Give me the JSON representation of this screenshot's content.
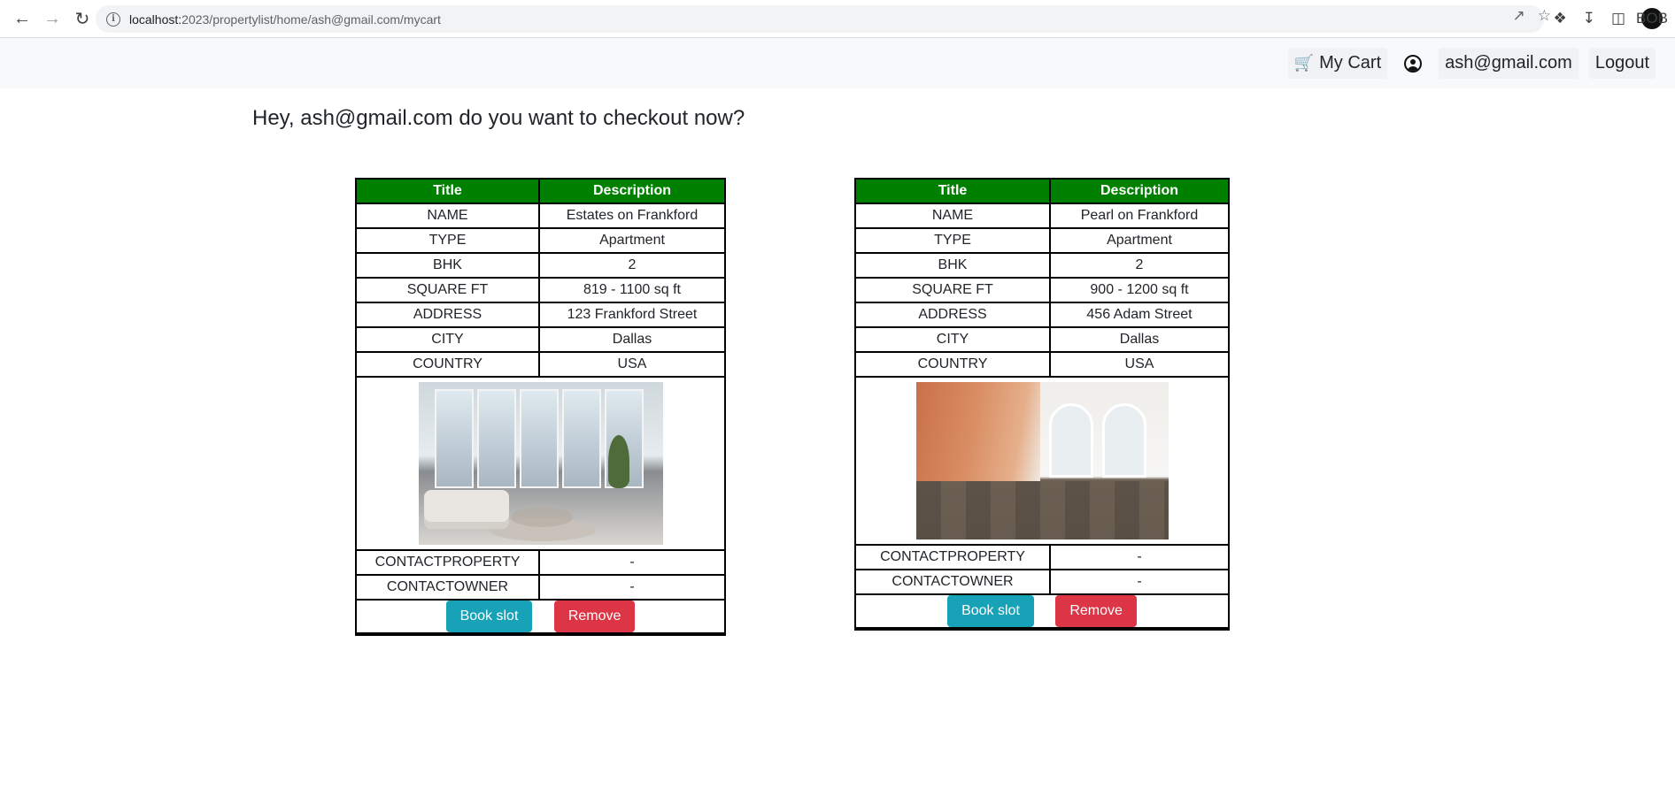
{
  "browser": {
    "url_host": "localhost:",
    "url_path": "2023/propertylist/home/ash@gmail.com/mycart",
    "avatar_text": "BOB"
  },
  "navbar": {
    "cart_label": "My Cart",
    "user_email": "ash@gmail.com",
    "logout_label": "Logout"
  },
  "page": {
    "greeting": "Hey, ash@gmail.com do you want to checkout now?"
  },
  "table_headers": {
    "title": "Title",
    "description": "Description"
  },
  "properties": [
    {
      "rows": [
        {
          "label": "NAME",
          "value": "Estates on Frankford"
        },
        {
          "label": "TYPE",
          "value": "Apartment"
        },
        {
          "label": "BHK",
          "value": "2"
        },
        {
          "label": "SQUARE FT",
          "value": "819 - 1100 sq ft"
        },
        {
          "label": "ADDRESS",
          "value": "123 Frankford Street"
        },
        {
          "label": "CITY",
          "value": "Dallas"
        },
        {
          "label": "COUNTRY",
          "value": "USA"
        }
      ],
      "contact_rows": [
        {
          "label": "CONTACTPROPERTY",
          "value": "-"
        },
        {
          "label": "CONTACTOWNER",
          "value": "-"
        }
      ],
      "book_label": "Book slot",
      "remove_label": "Remove"
    },
    {
      "rows": [
        {
          "label": "NAME",
          "value": "Pearl on Frankford"
        },
        {
          "label": "TYPE",
          "value": "Apartment"
        },
        {
          "label": "BHK",
          "value": "2"
        },
        {
          "label": "SQUARE FT",
          "value": "900 - 1200 sq ft"
        },
        {
          "label": "ADDRESS",
          "value": "456 Adam Street"
        },
        {
          "label": "CITY",
          "value": "Dallas"
        },
        {
          "label": "COUNTRY",
          "value": "USA"
        }
      ],
      "contact_rows": [
        {
          "label": "CONTACTPROPERTY",
          "value": "-"
        },
        {
          "label": "CONTACTOWNER",
          "value": "-"
        }
      ],
      "book_label": "Book slot",
      "remove_label": "Remove"
    }
  ],
  "colors": {
    "header_green": "#008000",
    "book_button": "#17a2b8",
    "remove_button": "#dc3545"
  }
}
